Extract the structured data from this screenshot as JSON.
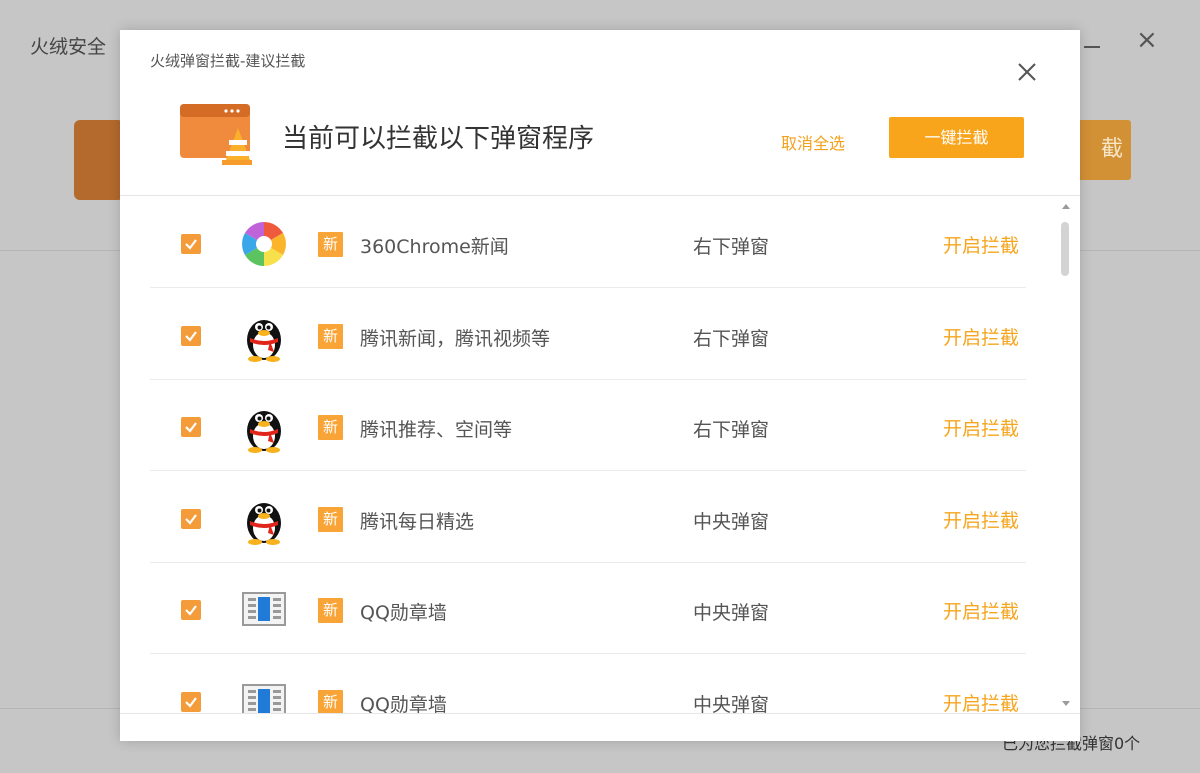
{
  "background_app": {
    "title": "火绒安全",
    "right_button_label": "截",
    "status_text": "已为您拦截弹窗0个"
  },
  "dialog": {
    "title": "火绒弹窗拦截-建议拦截",
    "heading": "当前可以拦截以下弹窗程序",
    "deselect_all": "取消全选",
    "block_all": "一键拦截",
    "badge_label": "新",
    "items": [
      {
        "icon": "360chrome-icon",
        "name": "360Chrome新闻",
        "type": "右下弹窗",
        "action": "开启拦截",
        "checked": true
      },
      {
        "icon": "qq-penguin-icon",
        "name": "腾讯新闻，腾讯视频等",
        "type": "右下弹窗",
        "action": "开启拦截",
        "checked": true
      },
      {
        "icon": "qq-penguin-icon",
        "name": "腾讯推荐、空间等",
        "type": "右下弹窗",
        "action": "开启拦截",
        "checked": true
      },
      {
        "icon": "qq-penguin-icon",
        "name": "腾讯每日精选",
        "type": "中央弹窗",
        "action": "开启拦截",
        "checked": true
      },
      {
        "icon": "qq-wall-icon",
        "name": "QQ勋章墙",
        "type": "中央弹窗",
        "action": "开启拦截",
        "checked": true
      },
      {
        "icon": "qq-wall-icon",
        "name": "QQ勋章墙",
        "type": "中央弹窗",
        "action": "开启拦截",
        "checked": true
      }
    ]
  },
  "colors": {
    "accent": "#f9a51c",
    "checkbox": "#f59c3a",
    "action_text": "#f6a51f"
  }
}
